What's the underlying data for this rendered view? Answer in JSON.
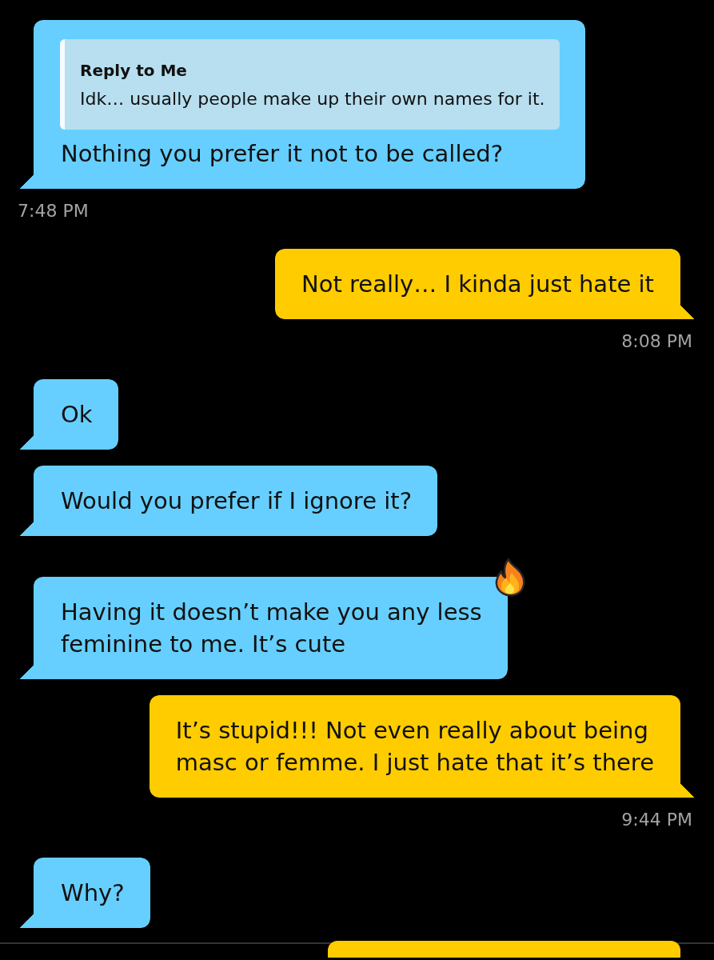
{
  "messages": [
    {
      "kind": "received",
      "reply": {
        "title": "Reply to Me",
        "text": "Idk… usually people make up their own names for it."
      },
      "text": "Nothing you prefer it not to be called?",
      "reacted": false,
      "time": "7:48 PM"
    },
    {
      "kind": "sent",
      "text": "Not really… I kinda just hate it",
      "reacted": false,
      "time": "8:08 PM"
    },
    {
      "kind": "received",
      "text": "Ok",
      "reacted": false
    },
    {
      "kind": "received",
      "text": "Would you prefer if I ignore it?",
      "reacted": false
    },
    {
      "kind": "received",
      "text": "Having it doesn’t make you any less\nfeminine to me. It’s cute",
      "reacted": true
    },
    {
      "kind": "sent",
      "text": "It’s stupid!!! Not even really about being\nmasc or femme. I just hate that it’s there",
      "reacted": false,
      "time": "9:44 PM"
    },
    {
      "kind": "received",
      "text": "Why?",
      "reacted": false
    },
    {
      "kind": "sent",
      "reacted": false
    }
  ]
}
